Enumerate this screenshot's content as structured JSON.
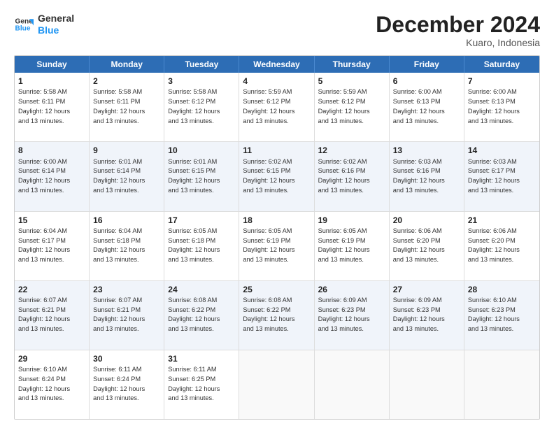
{
  "logo": {
    "line1": "General",
    "line2": "Blue"
  },
  "title": "December 2024",
  "subtitle": "Kuaro, Indonesia",
  "headers": [
    "Sunday",
    "Monday",
    "Tuesday",
    "Wednesday",
    "Thursday",
    "Friday",
    "Saturday"
  ],
  "weeks": [
    [
      {
        "day": "1",
        "text": "Sunrise: 5:58 AM\nSunset: 6:11 PM\nDaylight: 12 hours\nand 13 minutes."
      },
      {
        "day": "2",
        "text": "Sunrise: 5:58 AM\nSunset: 6:11 PM\nDaylight: 12 hours\nand 13 minutes."
      },
      {
        "day": "3",
        "text": "Sunrise: 5:58 AM\nSunset: 6:12 PM\nDaylight: 12 hours\nand 13 minutes."
      },
      {
        "day": "4",
        "text": "Sunrise: 5:59 AM\nSunset: 6:12 PM\nDaylight: 12 hours\nand 13 minutes."
      },
      {
        "day": "5",
        "text": "Sunrise: 5:59 AM\nSunset: 6:12 PM\nDaylight: 12 hours\nand 13 minutes."
      },
      {
        "day": "6",
        "text": "Sunrise: 6:00 AM\nSunset: 6:13 PM\nDaylight: 12 hours\nand 13 minutes."
      },
      {
        "day": "7",
        "text": "Sunrise: 6:00 AM\nSunset: 6:13 PM\nDaylight: 12 hours\nand 13 minutes."
      }
    ],
    [
      {
        "day": "8",
        "text": "Sunrise: 6:00 AM\nSunset: 6:14 PM\nDaylight: 12 hours\nand 13 minutes."
      },
      {
        "day": "9",
        "text": "Sunrise: 6:01 AM\nSunset: 6:14 PM\nDaylight: 12 hours\nand 13 minutes."
      },
      {
        "day": "10",
        "text": "Sunrise: 6:01 AM\nSunset: 6:15 PM\nDaylight: 12 hours\nand 13 minutes."
      },
      {
        "day": "11",
        "text": "Sunrise: 6:02 AM\nSunset: 6:15 PM\nDaylight: 12 hours\nand 13 minutes."
      },
      {
        "day": "12",
        "text": "Sunrise: 6:02 AM\nSunset: 6:16 PM\nDaylight: 12 hours\nand 13 minutes."
      },
      {
        "day": "13",
        "text": "Sunrise: 6:03 AM\nSunset: 6:16 PM\nDaylight: 12 hours\nand 13 minutes."
      },
      {
        "day": "14",
        "text": "Sunrise: 6:03 AM\nSunset: 6:17 PM\nDaylight: 12 hours\nand 13 minutes."
      }
    ],
    [
      {
        "day": "15",
        "text": "Sunrise: 6:04 AM\nSunset: 6:17 PM\nDaylight: 12 hours\nand 13 minutes."
      },
      {
        "day": "16",
        "text": "Sunrise: 6:04 AM\nSunset: 6:18 PM\nDaylight: 12 hours\nand 13 minutes."
      },
      {
        "day": "17",
        "text": "Sunrise: 6:05 AM\nSunset: 6:18 PM\nDaylight: 12 hours\nand 13 minutes."
      },
      {
        "day": "18",
        "text": "Sunrise: 6:05 AM\nSunset: 6:19 PM\nDaylight: 12 hours\nand 13 minutes."
      },
      {
        "day": "19",
        "text": "Sunrise: 6:05 AM\nSunset: 6:19 PM\nDaylight: 12 hours\nand 13 minutes."
      },
      {
        "day": "20",
        "text": "Sunrise: 6:06 AM\nSunset: 6:20 PM\nDaylight: 12 hours\nand 13 minutes."
      },
      {
        "day": "21",
        "text": "Sunrise: 6:06 AM\nSunset: 6:20 PM\nDaylight: 12 hours\nand 13 minutes."
      }
    ],
    [
      {
        "day": "22",
        "text": "Sunrise: 6:07 AM\nSunset: 6:21 PM\nDaylight: 12 hours\nand 13 minutes."
      },
      {
        "day": "23",
        "text": "Sunrise: 6:07 AM\nSunset: 6:21 PM\nDaylight: 12 hours\nand 13 minutes."
      },
      {
        "day": "24",
        "text": "Sunrise: 6:08 AM\nSunset: 6:22 PM\nDaylight: 12 hours\nand 13 minutes."
      },
      {
        "day": "25",
        "text": "Sunrise: 6:08 AM\nSunset: 6:22 PM\nDaylight: 12 hours\nand 13 minutes."
      },
      {
        "day": "26",
        "text": "Sunrise: 6:09 AM\nSunset: 6:23 PM\nDaylight: 12 hours\nand 13 minutes."
      },
      {
        "day": "27",
        "text": "Sunrise: 6:09 AM\nSunset: 6:23 PM\nDaylight: 12 hours\nand 13 minutes."
      },
      {
        "day": "28",
        "text": "Sunrise: 6:10 AM\nSunset: 6:23 PM\nDaylight: 12 hours\nand 13 minutes."
      }
    ],
    [
      {
        "day": "29",
        "text": "Sunrise: 6:10 AM\nSunset: 6:24 PM\nDaylight: 12 hours\nand 13 minutes."
      },
      {
        "day": "30",
        "text": "Sunrise: 6:11 AM\nSunset: 6:24 PM\nDaylight: 12 hours\nand 13 minutes."
      },
      {
        "day": "31",
        "text": "Sunrise: 6:11 AM\nSunset: 6:25 PM\nDaylight: 12 hours\nand 13 minutes."
      },
      {
        "day": "",
        "text": ""
      },
      {
        "day": "",
        "text": ""
      },
      {
        "day": "",
        "text": ""
      },
      {
        "day": "",
        "text": ""
      }
    ]
  ]
}
